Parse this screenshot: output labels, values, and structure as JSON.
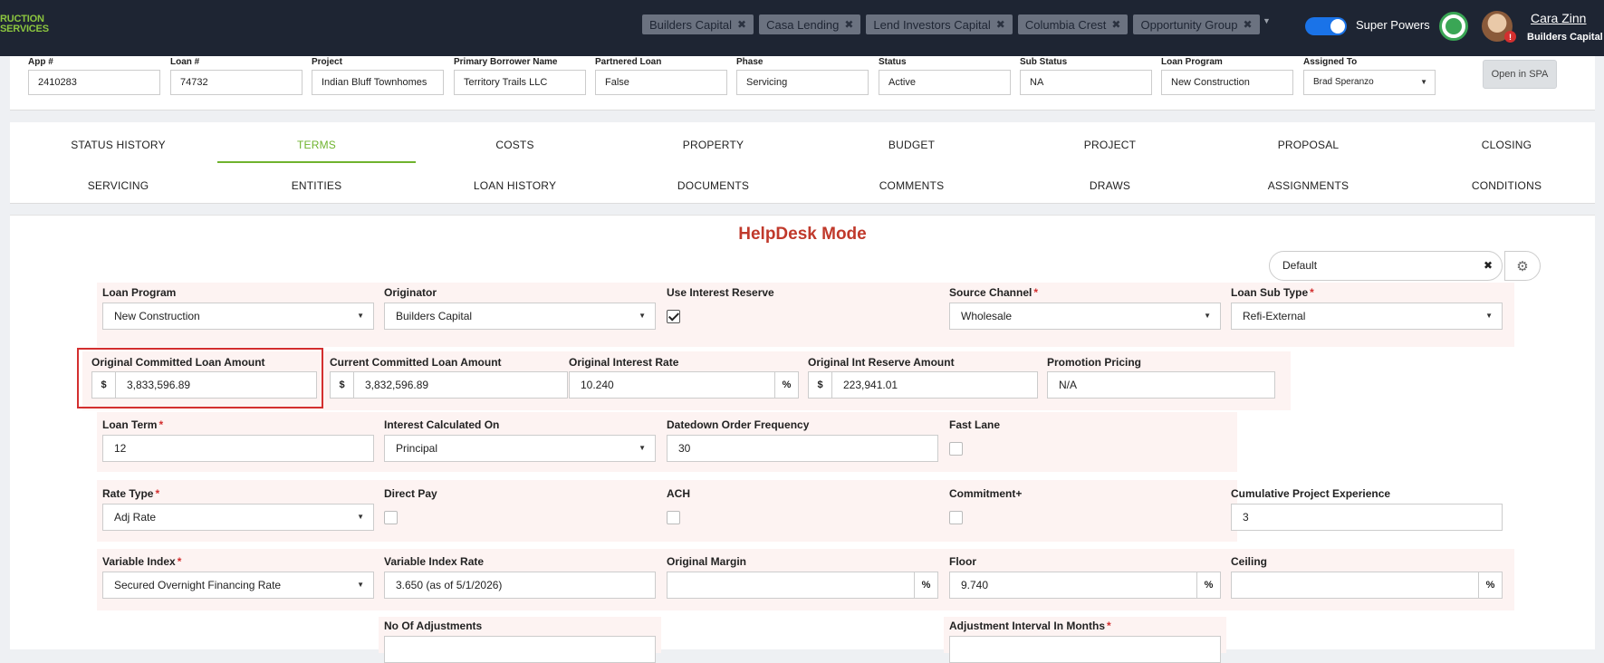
{
  "topbar": {
    "logo_line1": "RUCTION",
    "logo_line2": "SERVICES",
    "chips": [
      "Builders Capital",
      "Casa Lending",
      "Lend Investors Capital",
      "Columbia Crest",
      "Opportunity Group"
    ],
    "chip_remove": "✖",
    "super_powers_label": "Super Powers",
    "user_name": "Cara Zinn",
    "user_org": "Builders Capital",
    "notif_badge": "!"
  },
  "header_fields": [
    {
      "label": "App #",
      "value": "2410283"
    },
    {
      "label": "Loan #",
      "value": "74732"
    },
    {
      "label": "Project",
      "value": "Indian Bluff Townhomes"
    },
    {
      "label": "Primary Borrower Name",
      "value": "Territory Trails LLC"
    },
    {
      "label": "Partnered Loan",
      "value": "False"
    },
    {
      "label": "Phase",
      "value": "Servicing"
    },
    {
      "label": "Status",
      "value": "Active"
    },
    {
      "label": "Sub Status",
      "value": "NA"
    },
    {
      "label": "Loan Program",
      "value": "New Construction"
    },
    {
      "label": "Assigned To",
      "value": "Brad Speranzo"
    }
  ],
  "open_spa_label": "Open in SPA",
  "tabs_row1": [
    "STATUS HISTORY",
    "TERMS",
    "COSTS",
    "PROPERTY",
    "BUDGET",
    "PROJECT",
    "PROPOSAL",
    "CLOSING"
  ],
  "tabs_row2": [
    "SERVICING",
    "ENTITIES",
    "LOAN HISTORY",
    "DOCUMENTS",
    "COMMENTS",
    "DRAWS",
    "ASSIGNMENTS",
    "CONDITIONS"
  ],
  "active_tab": "TERMS",
  "helpdesk_title": "HelpDesk Mode",
  "view_select": "Default",
  "form": {
    "loan_program": {
      "label": "Loan Program",
      "value": "New Construction"
    },
    "originator": {
      "label": "Originator",
      "value": "Builders Capital"
    },
    "use_interest_reserve": {
      "label": "Use Interest Reserve",
      "checked": true
    },
    "source_channel": {
      "label": "Source Channel",
      "value": "Wholesale"
    },
    "loan_sub_type": {
      "label": "Loan Sub Type",
      "value": "Refi-External"
    },
    "orig_committed": {
      "label": "Original Committed Loan Amount",
      "prefix": "$",
      "value": "3,833,596.89"
    },
    "curr_committed": {
      "label": "Current Committed Loan Amount",
      "prefix": "$",
      "value": "3,832,596.89"
    },
    "orig_rate": {
      "label": "Original Interest Rate",
      "value": "10.240",
      "suffix": "%"
    },
    "orig_int_reserve": {
      "label": "Original Int Reserve Amount",
      "prefix": "$",
      "value": "223,941.01"
    },
    "promotion": {
      "label": "Promotion Pricing",
      "value": "N/A"
    },
    "loan_term": {
      "label": "Loan Term",
      "value": "12"
    },
    "interest_calc": {
      "label": "Interest Calculated On",
      "value": "Principal"
    },
    "datedown": {
      "label": "Datedown Order Frequency",
      "value": "30"
    },
    "fast_lane": {
      "label": "Fast Lane",
      "checked": false
    },
    "rate_type": {
      "label": "Rate Type",
      "value": "Adj Rate"
    },
    "direct_pay": {
      "label": "Direct Pay",
      "checked": false
    },
    "ach": {
      "label": "ACH",
      "checked": false
    },
    "commitment_plus": {
      "label": "Commitment+",
      "checked": false
    },
    "cum_exp": {
      "label": "Cumulative Project Experience",
      "value": "3"
    },
    "var_index": {
      "label": "Variable Index",
      "value": "Secured Overnight Financing Rate"
    },
    "var_index_rate": {
      "label": "Variable Index Rate",
      "value": "3.650 (as of 5/1/2026)"
    },
    "orig_margin": {
      "label": "Original Margin",
      "value": "",
      "suffix": "%"
    },
    "floor": {
      "label": "Floor",
      "value": "9.740",
      "suffix": "%"
    },
    "ceiling": {
      "label": "Ceiling",
      "value": "",
      "suffix": "%"
    },
    "no_adjustments": {
      "label": "No Of Adjustments"
    },
    "adj_interval": {
      "label": "Adjustment Interval In Months"
    }
  },
  "required_mark": "*",
  "colors": {
    "accent_green": "#6fb32e",
    "helpdesk_red": "#c0392b",
    "highlight_red": "#d32f2f",
    "topbar": "#1e2533"
  }
}
